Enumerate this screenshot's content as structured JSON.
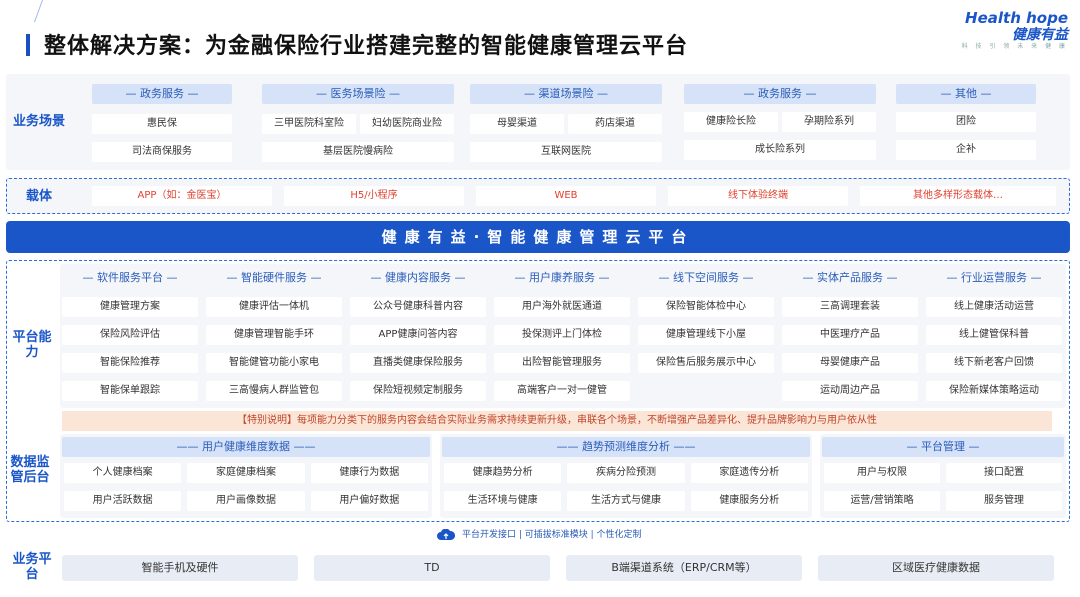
{
  "title": "整体解决方案：为金融保险行业搭建完整的智能健康管理云平台",
  "logo": {
    "en": "Health hope",
    "cn": "健康有益",
    "sub": "科 技 引 领 未 来 健 康"
  },
  "business": {
    "label": "业务场景",
    "groups": [
      {
        "header": "— 政务服务 —",
        "items": [
          "惠民保",
          "司法商保服务"
        ]
      },
      {
        "header": "— 医务场景险 —",
        "items": [
          "三甲医院科室险",
          "妇幼医院商业险",
          "基层医院慢病险"
        ]
      },
      {
        "header": "— 渠道场景险 —",
        "items": [
          "母婴渠道",
          "药店渠道",
          "互联网医院"
        ]
      },
      {
        "header": "— 政务服务 —",
        "items": [
          "健康险长险",
          "孕期险系列",
          "成长险系列"
        ]
      },
      {
        "header": "— 其他 —",
        "items": [
          "团险",
          "企补"
        ]
      }
    ]
  },
  "carrier": {
    "label": "载体",
    "items": [
      "APP（如：金医宝）",
      "H5/小程序",
      "WEB",
      "线下体验终端",
      "其他多样形态载体…"
    ]
  },
  "banner": "健康有益·智能健康管理云平台",
  "platform": {
    "label": "平台能力",
    "columns": [
      {
        "header": "— 软件服务平台 —",
        "items": [
          "健康管理方案",
          "保险风险评估",
          "智能保险推荐",
          "智能保单跟踪"
        ]
      },
      {
        "header": "— 智能硬件服务 —",
        "items": [
          "健康评估一体机",
          "健康管理智能手环",
          "智能健管功能小家电",
          "三高慢病人群监管包"
        ]
      },
      {
        "header": "— 健康内容服务 —",
        "items": [
          "公众号健康科普内容",
          "APP健康问答内容",
          "直播类健康保险服务",
          "保险短视频定制服务"
        ]
      },
      {
        "header": "— 用户康养服务 —",
        "items": [
          "用户海外就医通道",
          "投保测评上门体检",
          "出险智能管理服务",
          "高端客户一对一健管"
        ]
      },
      {
        "header": "— 线下空间服务 —",
        "items": [
          "保险智能体检中心",
          "健康管理线下小屋",
          "保险售后服务展示中心",
          ""
        ]
      },
      {
        "header": "— 实体产品服务 —",
        "items": [
          "三高调理套装",
          "中医理疗产品",
          "母婴健康产品",
          "运动周边产品"
        ]
      },
      {
        "header": "— 行业运营服务 —",
        "items": [
          "线上健康活动运营",
          "线上健管保科普",
          "线下新老客户回馈",
          "保险新媒体策略运动"
        ]
      }
    ],
    "notice": "【特别说明】每项能力分类下的服务内容会结合实际业务需求持续更新升级，串联各个场景，不断增强产品差异化、提升品牌影响力与用户依从性"
  },
  "data_backend": {
    "label": "数据监管后台",
    "groups": [
      {
        "header": "—— 用户健康维度数据 ——",
        "rows": [
          [
            "个人健康档案",
            "家庭健康档案",
            "健康行为数据"
          ],
          [
            "用户活跃数据",
            "用户画像数据",
            "用户偏好数据"
          ]
        ]
      },
      {
        "header": "—— 趋势预测维度分析 ——",
        "rows": [
          [
            "健康趋势分析",
            "疾病分险预测",
            "家庭遗传分析"
          ],
          [
            "生活环境与健康",
            "生活方式与健康",
            "健康服务分析"
          ]
        ]
      },
      {
        "header": "— 平台管理 —",
        "rows": [
          [
            "用户与权限",
            "接口配置"
          ],
          [
            "运营/营销策略",
            "服务管理"
          ]
        ]
      }
    ]
  },
  "api_line": "平台开发接口 | 可插拔标准模块 | 个性化定制",
  "business_platform": {
    "label": "业务平台",
    "items": [
      "智能手机及硬件",
      "TD",
      "B端渠道系统（ERP/CRM等）",
      "区域医疗健康数据"
    ]
  }
}
